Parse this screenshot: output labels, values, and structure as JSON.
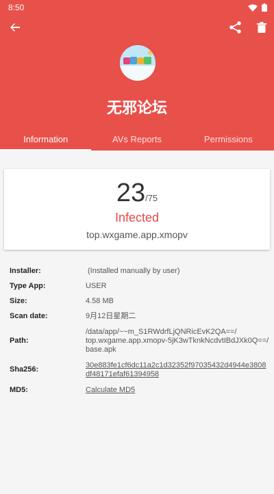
{
  "statusbar": {
    "time": "8:50",
    "wifi_icon": "wifi-icon",
    "battery_icon": "battery-icon"
  },
  "toolbar": {
    "back_icon": "arrow-back-icon",
    "share_icon": "share-icon",
    "delete_icon": "trash-icon"
  },
  "app": {
    "name": "无邪论坛",
    "icon": "app-logo-icon"
  },
  "tabs": [
    {
      "label": "Information",
      "active": true
    },
    {
      "label": "AVs Reports",
      "active": false
    },
    {
      "label": "Permissions",
      "active": false
    }
  ],
  "scan": {
    "detections": "23",
    "total": "/75",
    "verdict": "Infected",
    "package": "top.wxgame.app.xmopv"
  },
  "info": {
    "installer": {
      "label": "Installer:",
      "value": "(Installed manually by user)"
    },
    "type": {
      "label": "Type App:",
      "value": "USER"
    },
    "size": {
      "label": "Size:",
      "value": "4.58 MB"
    },
    "scan_date": {
      "label": "Scan date:",
      "value": "9月12日星期二"
    },
    "path": {
      "label": "Path:",
      "line1": "/data/app/~~m_S1RWdrfLjQNRicEvK2QA==/",
      "line2": "top.wxgame.app.xmopv-5jK3wTknkNcdvtIBdJXk0Q==/",
      "line3": "base.apk"
    },
    "sha256": {
      "label": "Sha256:",
      "line1": "30e883fe1cf6dc11a2c1d32352f97035432d4944e3808",
      "line2": "df48171efaf61394958"
    },
    "md5": {
      "label": "MD5:",
      "value": "Calculate MD5"
    }
  },
  "colors": {
    "accent": "#e8504a",
    "verdict": "#e04b44"
  }
}
